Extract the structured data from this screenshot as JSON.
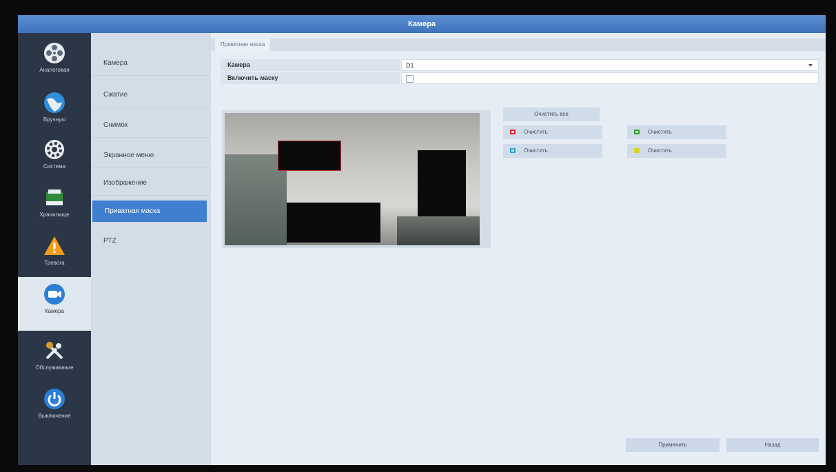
{
  "window": {
    "title": "Камера"
  },
  "leftnav": [
    {
      "label": "Аналоговая",
      "icon": "film-reel-icon"
    },
    {
      "label": "Вручную",
      "icon": "globe-icon"
    },
    {
      "label": "Система",
      "icon": "gear-icon"
    },
    {
      "label": "Хранилище",
      "icon": "storage-icon"
    },
    {
      "label": "Тревога",
      "icon": "warning-icon"
    },
    {
      "label": "Камера",
      "icon": "camera-icon",
      "active": true
    },
    {
      "label": "Обслуживание",
      "icon": "tools-icon"
    },
    {
      "label": "Выключение",
      "icon": "power-icon"
    }
  ],
  "submenu": [
    {
      "label": "Камера"
    },
    {
      "label": "Сжатие"
    },
    {
      "label": "Снимок"
    },
    {
      "label": "Экранное меню"
    },
    {
      "label": "Изображение"
    },
    {
      "label": "Приватная маска",
      "active": true
    },
    {
      "label": "PTZ"
    }
  ],
  "main": {
    "tab": "Приватная маска",
    "camera_label": "Камера",
    "camera_value": "D1",
    "enable_label": "Включить маску",
    "enable_checked": false,
    "clear_all": "Очистить все",
    "clear_buttons": [
      {
        "label": "Очистить",
        "color": "#e0222a"
      },
      {
        "label": "Очистить",
        "color": "#2fa12a"
      },
      {
        "label": "Очистить",
        "color": "#27a6e0"
      },
      {
        "label": "Очистить",
        "color": "#d9d626"
      }
    ],
    "apply": "Применить",
    "back": "Назад"
  }
}
